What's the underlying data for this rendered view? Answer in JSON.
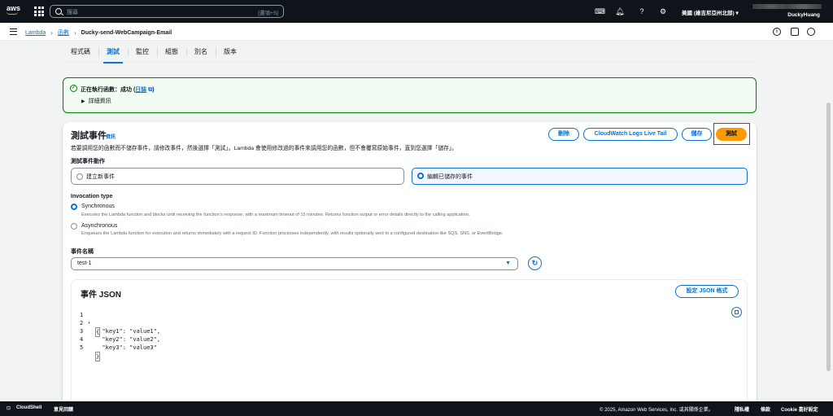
{
  "topnav": {
    "logo": "aws",
    "search_placeholder": "搜尋",
    "search_shortcut": "[選項+S]",
    "region": "美國 (維吉尼亞州北部) ▾",
    "account": "DuckyHuang",
    "icons": [
      "cloudshell-icon",
      "bell-icon",
      "help-icon",
      "gear-icon"
    ]
  },
  "breadcrumb": {
    "items": [
      "Lambda",
      "函數",
      "Ducky-send-WebCampaign-Email"
    ]
  },
  "tabs": [
    "程式碼",
    "測試",
    "監控",
    "組態",
    "別名",
    "版本"
  ],
  "active_tab": "測試",
  "banner": {
    "prefix": "正在執行函數：成功 (",
    "link": "日誌",
    "suffix": ")",
    "details": "詳細資訊"
  },
  "panel": {
    "title": "測試事件",
    "info": "資訊",
    "description": "若要調用您的函數而不儲存事件，請修改事件，然後選擇「測試」。Lambda 會使用修改過的事件來調用您的函數，但不會覆寫原始事件，直到您選擇「儲存」。",
    "buttons": {
      "delete": "刪除",
      "cloudwatch": "CloudWatch Logs Live Tail",
      "save": "儲存",
      "test": "測試"
    },
    "action_label": "測試事件動作",
    "action_new": "建立新事件",
    "action_edit": "編輯已儲存的事件",
    "invocation_label": "Invocation type",
    "sync_title": "Synchronous",
    "sync_desc": "Executes the Lambda function and blocks until receiving the function's response, with a maximum timeout of 15 minutes. Returns function output or error details directly to the calling application.",
    "async_title": "Asynchronous",
    "async_desc": "Enqueues the Lambda function for execution and returns immediately with a request ID. Function processes independently, with results optionally sent to a configured destination like SQS, SNS, or EventBridge.",
    "event_name_label": "事件名稱",
    "event_name_value": "test-1"
  },
  "json_editor": {
    "title": "事件 JSON",
    "format_button": "設定 JSON 格式",
    "lines": [
      {
        "n": "1",
        "text": "{"
      },
      {
        "n": "2",
        "text": "  \"key1\": \"value1\","
      },
      {
        "n": "3",
        "text": "  \"key2\": \"value2\","
      },
      {
        "n": "4",
        "text": "  \"key3\": \"value3\""
      },
      {
        "n": "5",
        "text": "}"
      }
    ]
  },
  "footer": {
    "cloudshell": "CloudShell",
    "feedback": "意見回饋",
    "copyright": "© 2025, Amazon Web Services, Inc. 或其關係企業。",
    "privacy": "隱私權",
    "terms": "條款",
    "cookie": "Cookie 喜好設定"
  },
  "colors": {
    "nav_bg": "#0f141a",
    "link": "#0972d3",
    "primary": "#ff9900",
    "success": "#037f0c",
    "highlight": "#d91515"
  }
}
